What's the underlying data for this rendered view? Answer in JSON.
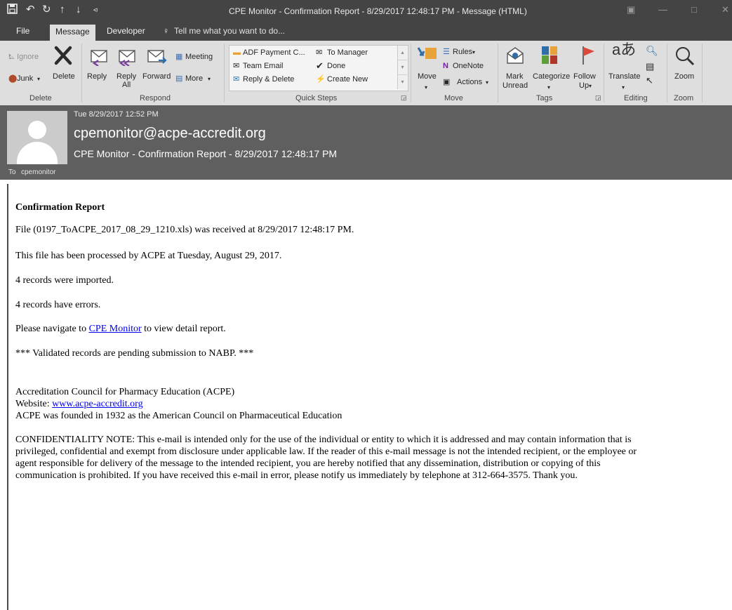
{
  "window": {
    "title": "CPE Monitor - Confirmation Report - 8/29/2017 12:48:17 PM  -  Message (HTML)"
  },
  "quick_access": {
    "save_icon": "save-icon",
    "undo_icon": "undo-icon",
    "redo_icon": "redo-icon",
    "prev_icon": "up-arrow-icon",
    "next_icon": "down-arrow-icon",
    "customize_icon": "customize-icon"
  },
  "menu": {
    "tabs": [
      "File",
      "Message",
      "Developer"
    ],
    "tell_me": "Tell me what you want to do..."
  },
  "ribbon": {
    "delete_group": {
      "ignore": "Ignore",
      "junk": "Junk",
      "delete": "Delete",
      "label": "Delete"
    },
    "respond_group": {
      "reply": "Reply",
      "reply_all_1": "Reply",
      "reply_all_2": "All",
      "forward": "Forward",
      "meeting": "Meeting",
      "more": "More",
      "label": "Respond"
    },
    "quick_steps": {
      "items": [
        "ADF Payment C...",
        "To Manager",
        "Team Email",
        "Done",
        "Reply & Delete",
        "Create New"
      ],
      "label": "Quick Steps"
    },
    "move_group": {
      "move": "Move",
      "rules": "Rules",
      "onenote": "OneNote",
      "actions": "Actions",
      "label": "Move"
    },
    "tags_group": {
      "mark_unread_1": "Mark",
      "mark_unread_2": "Unread",
      "categorize": "Categorize",
      "follow_1": "Follow",
      "follow_2": "Up",
      "label": "Tags"
    },
    "editing_group": {
      "translate": "Translate",
      "label": "Editing"
    },
    "zoom_group": {
      "zoom": "Zoom",
      "label": "Zoom"
    }
  },
  "message_header": {
    "date": "Tue 8/29/2017 12:52 PM",
    "from": "cpemonitor@acpe-accredit.org",
    "subject": "CPE Monitor - Confirmation Report - 8/29/2017 12:48:17 PM",
    "to_label": "To",
    "to_value": "cpemonitor"
  },
  "body": {
    "heading": "Confirmation Report",
    "line1": "File (0197_ToACPE_2017_08_29_1210.xls) was received at 8/29/2017 12:48:17 PM.",
    "line2": "This file has been processed by ACPE at Tuesday, August 29, 2017.",
    "line3": "4 records were imported.",
    "line4": "4 records have errors.",
    "nav_before": "Please navigate to ",
    "nav_link": "CPE Monitor",
    "nav_after": " to view detail report.",
    "pending": "*** Validated records are pending submission to NABP. ***",
    "org": "Accreditation Council for Pharmacy Education (ACPE)",
    "website_label": "Website: ",
    "website_link": "www.acpe-accredit.org",
    "founded": "ACPE was founded in 1932 as the American Council on Pharmaceutical Education",
    "confidentiality": [
      "CONFIDENTIALITY NOTE: This e-mail is intended only for the use of the individual or entity to which it is addressed and may contain information that is",
      "privileged, confidential and exempt from disclosure under applicable law. If the reader of this e-mail message is not the intended recipient, or the employee or",
      "agent responsible for delivery of the message to the intended recipient, you are hereby notified that any dissemination, distribution or copying of this",
      "communication is prohibited. If you have received this e-mail in error, please notify us immediately by telephone at 312-664-3575. Thank you."
    ]
  },
  "colors": {
    "titlebar": "#444444",
    "ribbon": "#dedede",
    "header": "#5f5f5f",
    "link": "#0000ee"
  }
}
